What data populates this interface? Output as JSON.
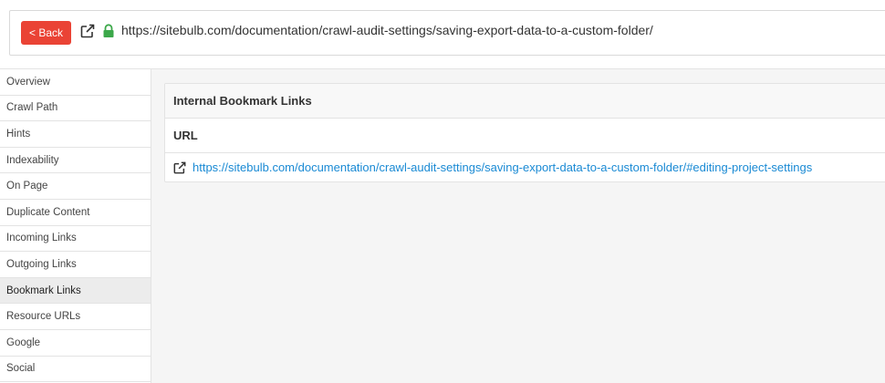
{
  "header": {
    "back_label": "< Back",
    "url": "https://sitebulb.com/documentation/crawl-audit-settings/saving-export-data-to-a-custom-folder/"
  },
  "sidebar": {
    "items": [
      {
        "label": "Overview"
      },
      {
        "label": "Crawl Path"
      },
      {
        "label": "Hints"
      },
      {
        "label": "Indexability"
      },
      {
        "label": "On Page"
      },
      {
        "label": "Duplicate Content"
      },
      {
        "label": "Incoming Links"
      },
      {
        "label": "Outgoing Links"
      },
      {
        "label": "Bookmark Links"
      },
      {
        "label": "Resource URLs"
      },
      {
        "label": "Google"
      },
      {
        "label": "Social"
      }
    ],
    "active": "Bookmark Links"
  },
  "panel": {
    "title": "Internal Bookmark Links",
    "column": "URL",
    "rows": [
      {
        "url": "https://sitebulb.com/documentation/crawl-audit-settings/saving-export-data-to-a-custom-folder/#editing-project-settings"
      }
    ]
  },
  "colors": {
    "back_button": "#ea4335",
    "lock": "#3ca84a",
    "link": "#1a8ad4"
  }
}
